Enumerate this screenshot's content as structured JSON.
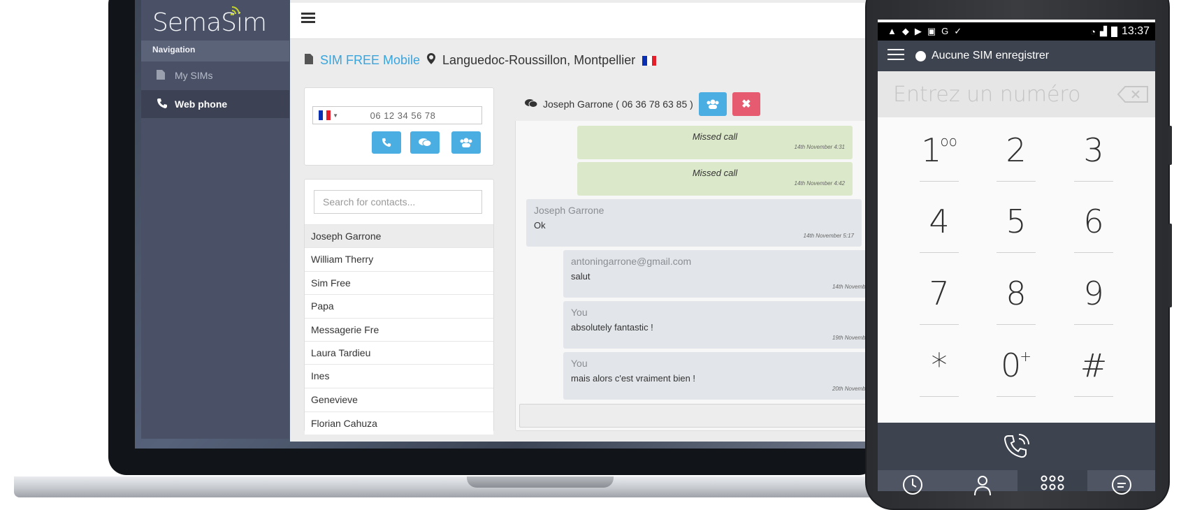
{
  "webapp": {
    "brand": "SemaSim",
    "nav_header": "Navigation",
    "nav_items": [
      {
        "label": "My SIMs",
        "icon": "sim-card-icon"
      },
      {
        "label": "Web phone",
        "icon": "phone-icon"
      }
    ],
    "carrier": "SIM FREE Mobile",
    "location": "Languedoc-Roussillon, Montpellier",
    "phone_number": "06 12 34 56 78",
    "search_placeholder": "Search for contacts...",
    "contacts": [
      "Joseph Garrone",
      "William Therry",
      "Sim Free",
      "Papa",
      "Messagerie Fre",
      "Laura Tardieu",
      "Ines",
      "Genevieve",
      "Florian Cahuza"
    ],
    "conversation_title": "Joseph Garrone ( 06 36 78 63 85 )",
    "messages": [
      {
        "text": "Missed call",
        "time": "14th November 4:31"
      },
      {
        "text": "Missed call",
        "time": "14th November 4:42"
      },
      {
        "sender": "Joseph Garrone",
        "text": "Ok",
        "time": "14th November 5:17"
      },
      {
        "sender": "antoningarrone@gmail.com",
        "text": "salut",
        "time": "14th Novembe"
      },
      {
        "sender": "You",
        "text": "absolutely fantastic !",
        "time": "19th Novembe"
      },
      {
        "sender": "You",
        "text": "mais alors c'est vraiment bien !",
        "time": "20th Novembe"
      }
    ]
  },
  "phone": {
    "time": "13:37",
    "sim_status": "Aucune SIM enregistrer",
    "number_placeholder": "Entrez un numéro",
    "keys": [
      {
        "digit": "1",
        "sup": "oo"
      },
      {
        "digit": "2",
        "sup": ""
      },
      {
        "digit": "3",
        "sup": ""
      },
      {
        "digit": "4",
        "sup": ""
      },
      {
        "digit": "5",
        "sup": ""
      },
      {
        "digit": "6",
        "sup": ""
      },
      {
        "digit": "7",
        "sup": ""
      },
      {
        "digit": "8",
        "sup": ""
      },
      {
        "digit": "9",
        "sup": ""
      },
      {
        "digit": "*",
        "sup": ""
      },
      {
        "digit": "0",
        "sup": "+"
      },
      {
        "digit": "#",
        "sup": ""
      }
    ]
  },
  "colors": {
    "accent": "#4aaee3",
    "danger": "#e65b6f",
    "sidebar": "#4a5166",
    "missed_call_bubble": "#dbe8c9"
  }
}
